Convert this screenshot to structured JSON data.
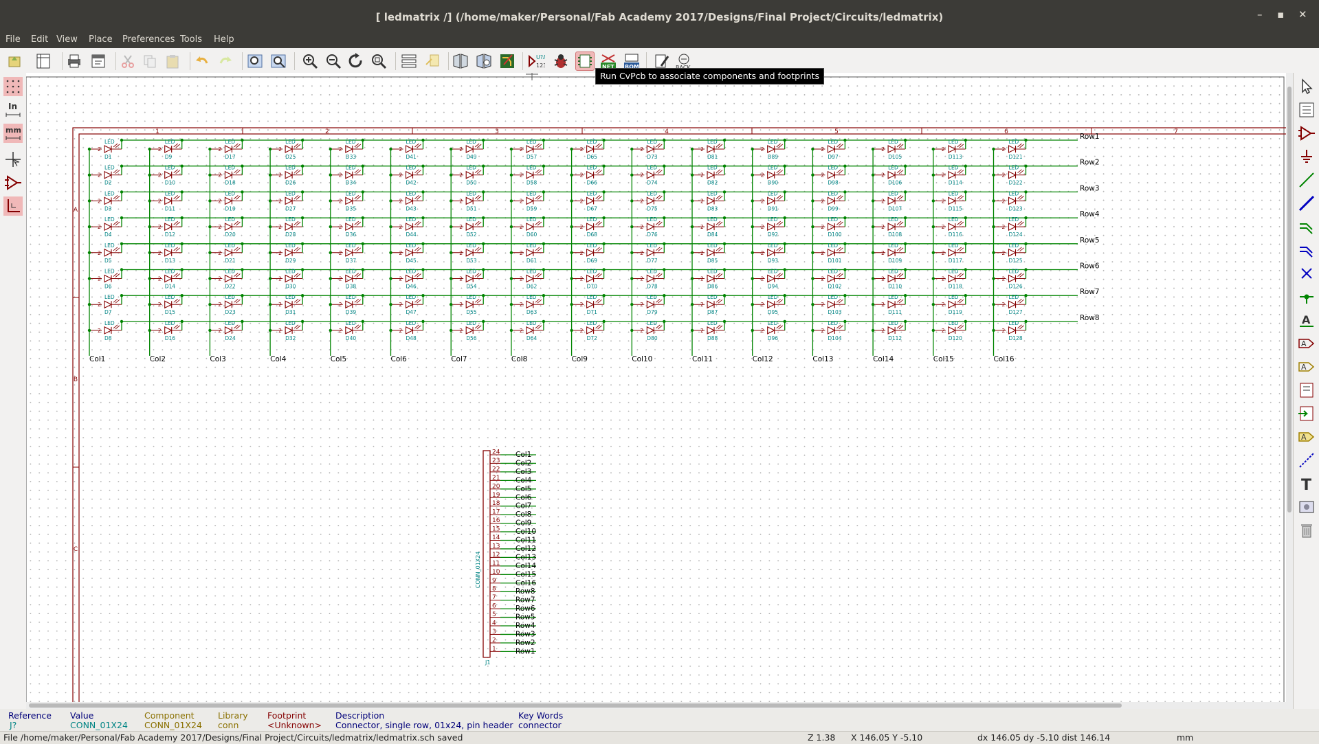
{
  "window": {
    "title": "[ ledmatrix /] (/home/maker/Personal/Fab Academy 2017/Designs/Final Project/Circuits/ledmatrix)",
    "controls": [
      "–",
      "▪",
      "✕"
    ]
  },
  "menu": [
    "File",
    "Edit",
    "View",
    "Place",
    "Preferences",
    "Tools",
    "Help"
  ],
  "toolbar": {
    "items": [
      {
        "name": "new-schematic-icon"
      },
      {
        "name": "page-settings-icon"
      },
      {
        "name": "print-icon"
      },
      {
        "name": "plot-icon"
      },
      {
        "name": "cut-icon"
      },
      {
        "name": "copy-icon"
      },
      {
        "name": "paste-icon"
      },
      {
        "name": "undo-icon"
      },
      {
        "name": "redo-icon"
      },
      {
        "name": "find-icon"
      },
      {
        "name": "find-replace-icon"
      },
      {
        "name": "zoom-in-icon"
      },
      {
        "name": "zoom-out-icon"
      },
      {
        "name": "zoom-redraw-icon"
      },
      {
        "name": "zoom-fit-icon"
      },
      {
        "name": "hierarchy-navigator-icon"
      },
      {
        "name": "leave-sheet-icon"
      },
      {
        "name": "library-editor-icon"
      },
      {
        "name": "library-browser-icon"
      },
      {
        "name": "pcb-editor-icon"
      },
      {
        "name": "annotate-icon"
      },
      {
        "name": "erc-icon"
      },
      {
        "name": "cvpcb-icon"
      },
      {
        "name": "netlist-icon"
      },
      {
        "name": "bom-icon"
      },
      {
        "name": "edit-fields-icon"
      },
      {
        "name": "back-annotate-icon"
      }
    ],
    "annotate_label": "U?A\n123",
    "netlist_label": "NET",
    "bom_label": "BOM",
    "back_label": "BACK"
  },
  "left_toolbar": {
    "grid": "grid-icon",
    "inches_label": "In",
    "mm_label": "mm",
    "cursor": "full-cursor-icon",
    "hidden_pins": "hidden-pins-icon",
    "wire_orient": "wire-orientation-icon"
  },
  "right_toolbar": [
    "select-icon",
    "hierarchy-icon",
    "add-component-icon",
    "add-power-icon",
    "add-wire-icon",
    "add-bus-icon",
    "wire-entry-icon",
    "bus-entry-icon",
    "no-connect-icon",
    "junction-icon",
    "net-label-icon",
    "global-label-icon",
    "hier-label-icon",
    "hier-sheet-icon",
    "import-pin-icon",
    "add-pin-icon",
    "add-line-icon",
    "add-text-icon",
    "add-image-icon",
    "delete-icon"
  ],
  "tooltip": "Run CvPcb to associate components and footprints",
  "schematic": {
    "frame_columns": [
      "1",
      "2",
      "3",
      "4",
      "5",
      "6",
      "7"
    ],
    "frame_rows": [
      "A",
      "B",
      "C"
    ],
    "led_value": "LED",
    "pin_label": "2",
    "row_labels": [
      "Row1",
      "Row2",
      "Row3",
      "Row4",
      "Row5",
      "Row6",
      "Row7",
      "Row8"
    ],
    "col_labels": [
      "Col1",
      "Col2",
      "Col3",
      "Col4",
      "Col5",
      "Col6",
      "Col7",
      "Col8",
      "Col9",
      "Col10",
      "Col11",
      "Col12",
      "Col13",
      "Col14",
      "Col15",
      "Col16"
    ],
    "connector": {
      "ref": "J1",
      "value": "CONN_01X24",
      "pins": [
        {
          "num": "24",
          "net": "Col1"
        },
        {
          "num": "23",
          "net": "Col2"
        },
        {
          "num": "22",
          "net": "Col3"
        },
        {
          "num": "21",
          "net": "Col4"
        },
        {
          "num": "20",
          "net": "Col5"
        },
        {
          "num": "19",
          "net": "Col6"
        },
        {
          "num": "18",
          "net": "Col7"
        },
        {
          "num": "17",
          "net": "Col8"
        },
        {
          "num": "16",
          "net": "Col9"
        },
        {
          "num": "15",
          "net": "Col10"
        },
        {
          "num": "14",
          "net": "Col11"
        },
        {
          "num": "13",
          "net": "Col12"
        },
        {
          "num": "12",
          "net": "Col13"
        },
        {
          "num": "11",
          "net": "Col14"
        },
        {
          "num": "10",
          "net": "Col15"
        },
        {
          "num": "9",
          "net": "Col16"
        },
        {
          "num": "8",
          "net": "Row8"
        },
        {
          "num": "7",
          "net": "Row7"
        },
        {
          "num": "6",
          "net": "Row6"
        },
        {
          "num": "5",
          "net": "Row5"
        },
        {
          "num": "4",
          "net": "Row4"
        },
        {
          "num": "3",
          "net": "Row3"
        },
        {
          "num": "2",
          "net": "Row2"
        },
        {
          "num": "1",
          "net": "Row1"
        }
      ]
    }
  },
  "message_panel": {
    "reference": {
      "label": "Reference",
      "value": "J?"
    },
    "value": {
      "label": "Value",
      "value": "CONN_01X24"
    },
    "component": {
      "label": "Component",
      "value": "CONN_01X24"
    },
    "library": {
      "label": "Library",
      "value": "conn"
    },
    "footprint": {
      "label": "Footprint",
      "value": "<Unknown>"
    },
    "description": {
      "label": "Description",
      "value": "Connector, single row, 01x24, pin header"
    },
    "keywords": {
      "label": "Key Words",
      "value": "connector"
    }
  },
  "status": {
    "file": "File /home/maker/Personal/Fab Academy 2017/Designs/Final Project/Circuits/ledmatrix/ledmatrix.sch saved",
    "zoom": "Z 1.38",
    "coords": "X 146.05  Y -5.10",
    "delta": "dx 146.05  dy -5.10  dist 146.14",
    "units": "mm"
  },
  "colors": {
    "wire": "#008400",
    "component": "#840000",
    "reference": "#008484",
    "label": "#000000",
    "frame": "#840000",
    "accent": "#e07070"
  }
}
